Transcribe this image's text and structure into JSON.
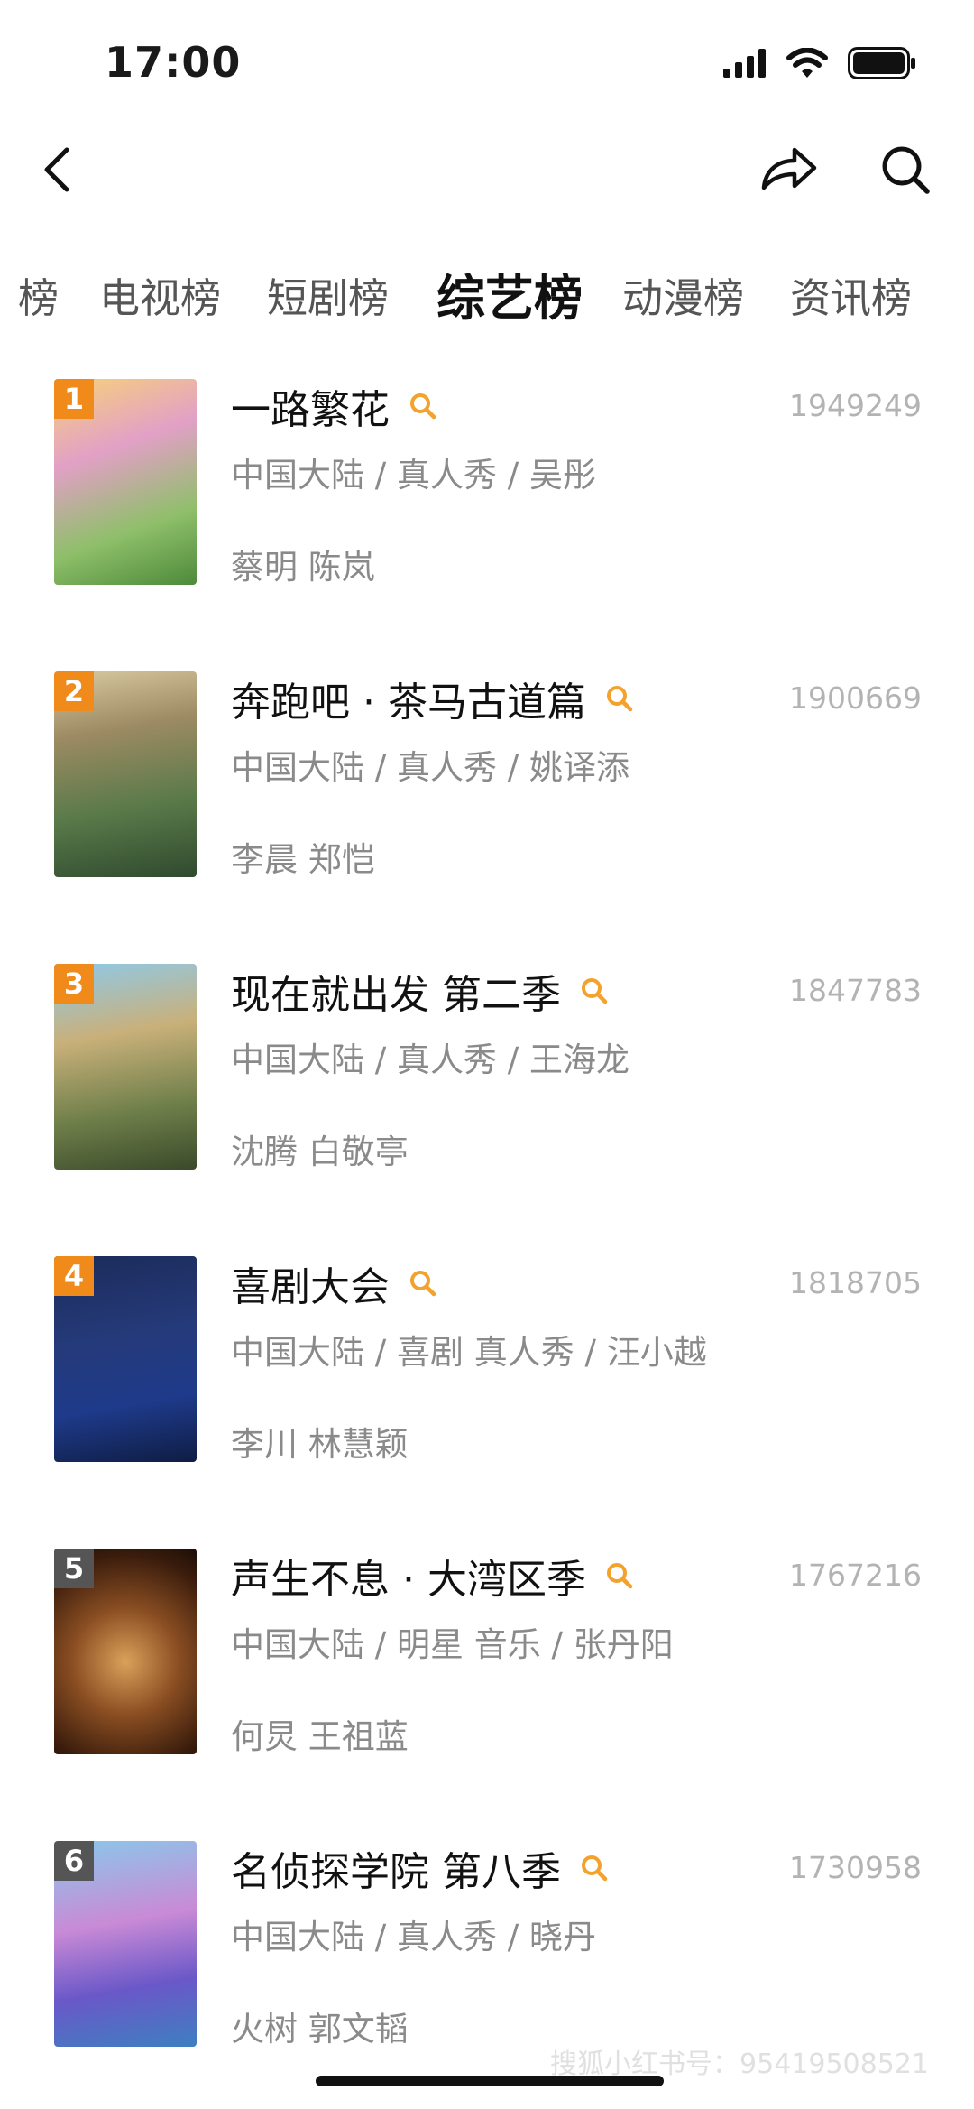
{
  "status": {
    "time": "17:00"
  },
  "tabs": [
    {
      "label": "榜",
      "active": false
    },
    {
      "label": "电视榜",
      "active": false
    },
    {
      "label": "短剧榜",
      "active": false
    },
    {
      "label": "综艺榜",
      "active": true
    },
    {
      "label": "动漫榜",
      "active": false
    },
    {
      "label": "资讯榜",
      "active": false
    }
  ],
  "items": [
    {
      "rank": "1",
      "title": "一路繁花",
      "meta": "中国大陆 / 真人秀 / 吴彤",
      "cast": "蔡明 陈岚",
      "score": "1949249"
    },
    {
      "rank": "2",
      "title": "奔跑吧 · 茶马古道篇",
      "meta": "中国大陆 / 真人秀 / 姚译添",
      "cast": "李晨 郑恺",
      "score": "1900669"
    },
    {
      "rank": "3",
      "title": "现在就出发 第二季",
      "meta": "中国大陆 / 真人秀 / 王海龙",
      "cast": "沈腾 白敬亭",
      "score": "1847783"
    },
    {
      "rank": "4",
      "title": "喜剧大会",
      "meta": "中国大陆 / 喜剧 真人秀 / 汪小越",
      "cast": "李川 林慧颖",
      "score": "1818705"
    },
    {
      "rank": "5",
      "title": "声生不息 · 大湾区季",
      "meta": "中国大陆 / 明星 音乐 / 张丹阳",
      "cast": "何炅 王祖蓝",
      "score": "1767216"
    },
    {
      "rank": "6",
      "title": "名侦探学院 第八季",
      "meta": "中国大陆 / 真人秀 / 晓丹",
      "cast": "火树 郭文韬",
      "score": "1730958"
    }
  ],
  "colors": {
    "rank_top": "#f08a1a",
    "rank_other": "#555555",
    "accent": "#f2a22d",
    "muted": "#8a8a8a"
  },
  "watermark": "搜狐小红书号：95419508521"
}
